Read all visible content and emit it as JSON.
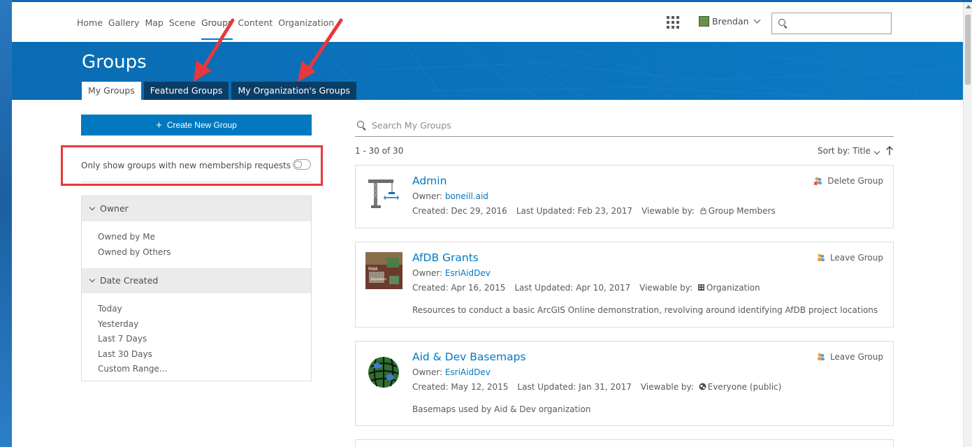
{
  "nav": {
    "links": [
      "Home",
      "Gallery",
      "Map",
      "Scene",
      "Groups",
      "Content",
      "Organization"
    ],
    "active": "Groups",
    "user_name": "Brendan"
  },
  "banner": {
    "title": "Groups",
    "tabs": [
      "My Groups",
      "Featured Groups",
      "My Organization's Groups"
    ]
  },
  "sidebar": {
    "create_label": "Create New Group",
    "membership_toggle_label": "Only show groups with new membership requests",
    "filters": [
      {
        "heading": "Owner",
        "options": [
          "Owned by Me",
          "Owned by Others"
        ]
      },
      {
        "heading": "Date Created",
        "options": [
          "Today",
          "Yesterday",
          "Last 7 Days",
          "Last 30 Days",
          "Custom Range..."
        ]
      }
    ]
  },
  "results": {
    "search_placeholder": "Search My Groups",
    "count": "1 - 30 of 30",
    "sort_label": "Sort by: Title",
    "groups": [
      {
        "title": "Admin",
        "owner_label": "Owner: ",
        "owner": "boneill.aid",
        "created": "Created: Dec 29, 2016",
        "updated": "Last Updated: Feb 23, 2017",
        "viewable_label": "Viewable by:",
        "viewable": "Group Members",
        "description": "",
        "action": "Delete Group"
      },
      {
        "title": "AfDB Grants",
        "owner_label": "Owner: ",
        "owner": "EsriAidDev",
        "created": "Created: Apr 16, 2015",
        "updated": "Last Updated: Apr 10, 2017",
        "viewable_label": "Viewable by:",
        "viewable": "Organization",
        "description": "Resources to conduct a basic ArcGIS Online demonstration, revolving around identifying AfDB project locations",
        "action": "Leave Group"
      },
      {
        "title": "Aid & Dev Basemaps",
        "owner_label": "Owner: ",
        "owner": "EsriAidDev",
        "created": "Created: May 12, 2015",
        "updated": "Last Updated: Jan 31, 2017",
        "viewable_label": "Viewable by:",
        "viewable": "Everyone (public)",
        "description": "Basemaps used by Aid & Dev organization",
        "action": "Leave Group"
      }
    ]
  },
  "colors": {
    "accent": "#0079c1",
    "banner": "#0a73bd",
    "tab_dark": "#0b3e66",
    "annotation_red": "#e8383b"
  }
}
